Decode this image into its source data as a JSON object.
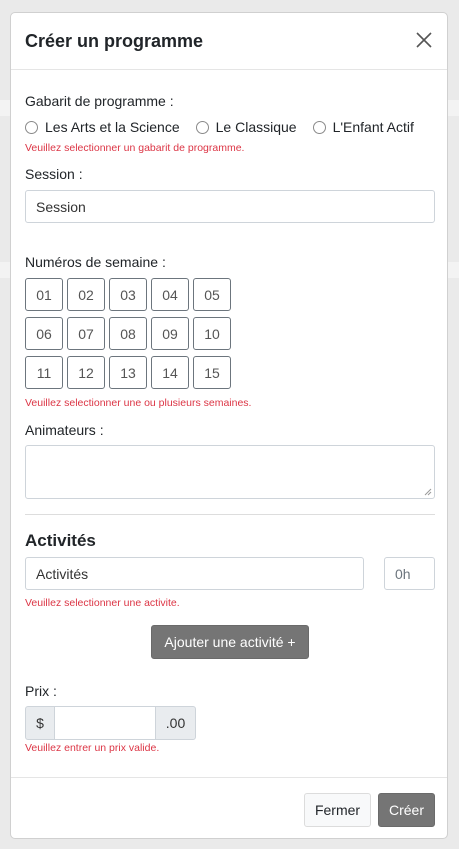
{
  "modal": {
    "title": "Créer un programme"
  },
  "template": {
    "label": "Gabarit de programme :",
    "options": [
      "Les Arts et la Science",
      "Le Classique",
      "L'Enfant Actif"
    ],
    "error": "Veuillez selectionner un gabarit de programme."
  },
  "session": {
    "label": "Session :",
    "value": "Session"
  },
  "weeks": {
    "label": "Numéros de semaine :",
    "numbers": [
      "01",
      "02",
      "03",
      "04",
      "05",
      "06",
      "07",
      "08",
      "09",
      "10",
      "11",
      "12",
      "13",
      "14",
      "15"
    ],
    "error": "Veuillez selectionner une ou plusieurs semaines."
  },
  "animators": {
    "label": "Animateurs :",
    "value": ""
  },
  "activities": {
    "title": "Activités",
    "select_value": "Activités",
    "hours_placeholder": "0h",
    "error": "Veuillez selectionner une activite.",
    "add_button": "Ajouter une activité +"
  },
  "price": {
    "label": "Prix :",
    "prefix": "$",
    "value": "",
    "suffix": ".00",
    "error": "Veuillez entrer un prix valide."
  },
  "footer": {
    "close_label": "Fermer",
    "create_label": "Créer"
  }
}
